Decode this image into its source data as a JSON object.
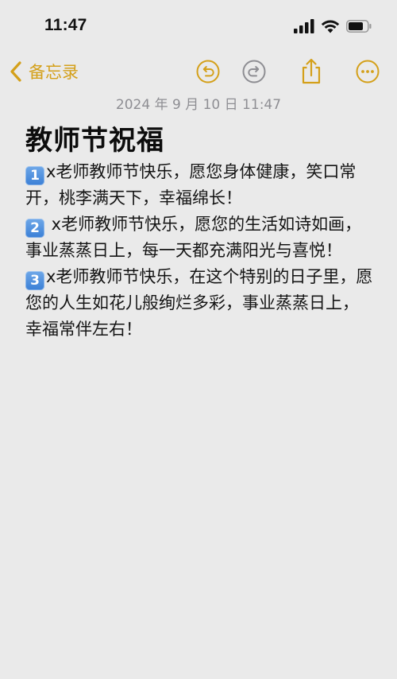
{
  "status_bar": {
    "time": "11:47",
    "icons": [
      "signal-icon",
      "wifi-icon",
      "battery-icon"
    ]
  },
  "toolbar": {
    "back_label": "备忘录",
    "buttons": [
      "undo-icon",
      "redo-icon",
      "share-icon",
      "more-icon"
    ],
    "accent_color": "#d4a01a"
  },
  "note": {
    "date": "2024 年 9 月 10 日 11:47",
    "title": "教师节祝福",
    "paragraphs": [
      {
        "badge": "1",
        "text": "x老师教师节快乐，愿您身体健康，笑口常开，桃李满天下，幸福绵长！"
      },
      {
        "badge": "2",
        "text": " x老师教师节快乐，愿您的生活如诗如画，事业蒸蒸日上，每一天都充满阳光与喜悦！"
      },
      {
        "badge": "3",
        "text": "x老师教师节快乐，在这个特别的日子里，愿您的人生如花儿般绚烂多彩，事业蒸蒸日上，幸福常伴左右！"
      }
    ]
  },
  "colors": {
    "background": "#eaeaea",
    "accent": "#d4a01a",
    "date_gray": "#8e8e93",
    "keycap_blue": "#4a8fe0"
  }
}
